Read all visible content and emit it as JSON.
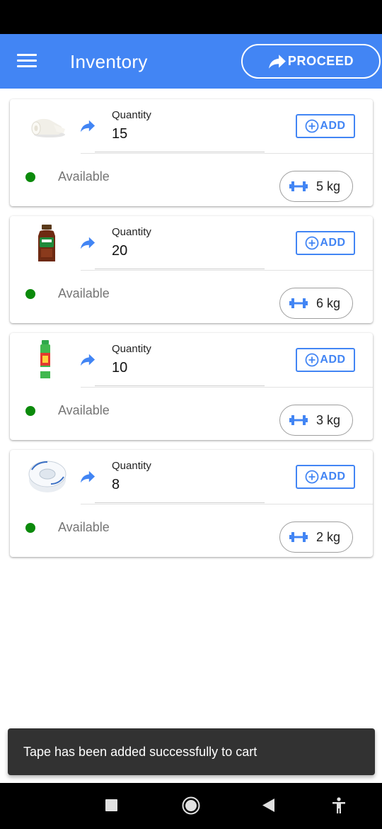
{
  "app_bar": {
    "title": "Inventory",
    "proceed_label": "PROCEED",
    "color": "#4285f4"
  },
  "items": [
    {
      "product": "bandage roll",
      "quantity_label": "Quantity",
      "quantity": "15",
      "add_label": "ADD",
      "status": "Available",
      "weight": "5 kg"
    },
    {
      "product": "antiseptic bottle",
      "quantity_label": "Quantity",
      "quantity": "20",
      "add_label": "ADD",
      "status": "Available",
      "weight": "6 kg"
    },
    {
      "product": "spray can",
      "quantity_label": "Quantity",
      "quantity": "10",
      "add_label": "ADD",
      "status": "Available",
      "weight": "3 kg"
    },
    {
      "product": "tape roll",
      "quantity_label": "Quantity",
      "quantity": "8",
      "add_label": "ADD",
      "status": "Available",
      "weight": "2 kg"
    }
  ],
  "snackbar": {
    "message": "Tape has been added successfully to cart"
  },
  "nav": {
    "icons": [
      "recent-apps-icon",
      "home-icon",
      "back-icon",
      "accessibility-icon"
    ]
  },
  "colors": {
    "accent": "#4285f4",
    "available": "#0b8a0b"
  }
}
